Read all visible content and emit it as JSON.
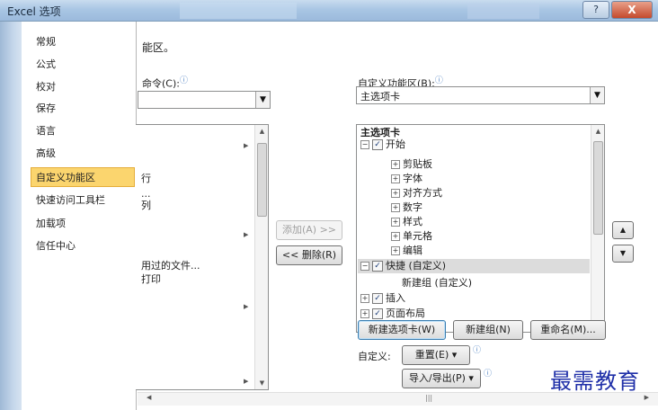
{
  "window": {
    "title": "Excel 选项",
    "help_label": "?",
    "close_label": "X"
  },
  "nav": {
    "items": [
      "常规",
      "公式",
      "校对",
      "保存",
      "语言",
      "高级",
      "自定义功能区",
      "快速访问工具栏",
      "加载项",
      "信任中心"
    ],
    "selected": "自定义功能区"
  },
  "left_panel": {
    "heading_fragment": "能区。",
    "commands_label": "命令(C):",
    "commands_value": "",
    "list_items": [
      "行",
      "...",
      "列",
      "用过的文件...",
      "打印"
    ]
  },
  "middle": {
    "add_label": "添加(A) >>",
    "remove_label": "<< 删除(R)"
  },
  "right_panel": {
    "customize_label": "自定义功能区(B):",
    "combo_value": "主选项卡",
    "tree_header": "主选项卡",
    "tree": [
      {
        "text": "开始",
        "level": 0,
        "expander": "⊟",
        "checked": true
      },
      {
        "text": "剪贴板",
        "level": 1,
        "expander": "⊞"
      },
      {
        "text": "字体",
        "level": 1,
        "expander": "⊞"
      },
      {
        "text": "对齐方式",
        "level": 1,
        "expander": "⊞"
      },
      {
        "text": "数字",
        "level": 1,
        "expander": "⊞"
      },
      {
        "text": "样式",
        "level": 1,
        "expander": "⊞"
      },
      {
        "text": "单元格",
        "level": 1,
        "expander": "⊞"
      },
      {
        "text": "编辑",
        "level": 1,
        "expander": "⊞"
      },
      {
        "text": "快捷 (自定义)",
        "level": 0,
        "expander": "⊟",
        "checked": true,
        "selected": true
      },
      {
        "text": "新建组 (自定义)",
        "level": 2
      },
      {
        "text": "插入",
        "level": 0,
        "expander": "⊞",
        "checked": true
      },
      {
        "text": "页面布局",
        "level": 0,
        "expander": "⊞",
        "checked": true
      }
    ],
    "new_tab_label": "新建选项卡(W)",
    "new_group_label": "新建组(N)",
    "rename_label": "重命名(M)...",
    "customizations_label": "自定义:",
    "reset_label": "重置(E) ▾",
    "import_export_label": "导入/导出(P) ▾"
  },
  "watermark": "最需教育",
  "colors": {
    "selected_nav_bg": "#fbd56e",
    "title_bar": "#a9c6e4",
    "watermark": "#1f2fa8"
  }
}
